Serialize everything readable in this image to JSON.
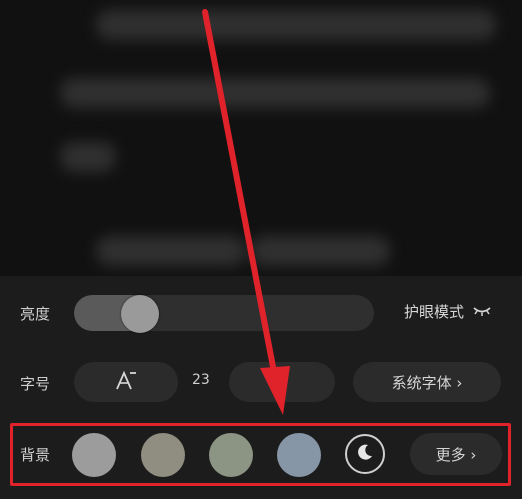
{
  "brightness": {
    "label": "亮度",
    "level_percent": 22,
    "eye_mode_label": "护眼模式",
    "eye_icon": "closed-eye-icon"
  },
  "font": {
    "label": "字号",
    "decrease_icon": "font-decrease-icon",
    "size_value": "23",
    "family_label": "系统字体 ›"
  },
  "background": {
    "label": "背景",
    "swatches": [
      "#9c9c9c",
      "#8f8e80",
      "#8c9483",
      "#8796a6"
    ],
    "night_icon": "moon-icon",
    "more_label": "更多 ›"
  },
  "annotation": {
    "color": "#e0222b"
  }
}
